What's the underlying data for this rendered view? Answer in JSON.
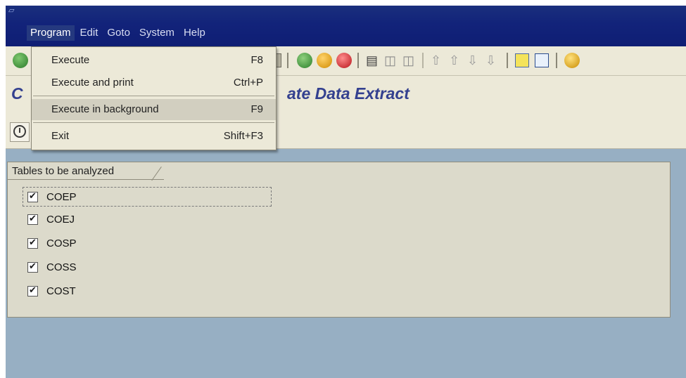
{
  "menubar": {
    "items": [
      {
        "label": "Program"
      },
      {
        "label": "Edit"
      },
      {
        "label": "Goto"
      },
      {
        "label": "System"
      },
      {
        "label": "Help"
      }
    ]
  },
  "page": {
    "title_left": "C",
    "title_right": "ate Data Extract"
  },
  "dropdown": {
    "items": [
      {
        "label": "Execute",
        "shortcut": "F8"
      },
      {
        "label": "Execute and print",
        "shortcut": "Ctrl+P"
      },
      {
        "label": "Execute in background",
        "shortcut": "F9"
      },
      {
        "label": "Exit",
        "shortcut": "Shift+F3"
      }
    ]
  },
  "group": {
    "title": "Tables to be analyzed",
    "tables": [
      {
        "label": "COEP",
        "checked": true
      },
      {
        "label": "COEJ",
        "checked": true
      },
      {
        "label": "COSP",
        "checked": true
      },
      {
        "label": "COSS",
        "checked": true
      },
      {
        "label": "COST",
        "checked": true
      }
    ]
  },
  "colors": {
    "title_bar": "#12237a",
    "background": "#97afc3",
    "panel": "#ece9d8",
    "title_text": "#33408f"
  },
  "icons": [
    "check-icon",
    "back-icon",
    "exit-icon",
    "cancel-icon",
    "print-icon",
    "find-icon",
    "find-next-icon",
    "first-page-icon",
    "prev-page-icon",
    "next-page-icon",
    "last-page-icon",
    "create-session-icon",
    "shortcut-icon",
    "help-icon",
    "clock-icon"
  ]
}
